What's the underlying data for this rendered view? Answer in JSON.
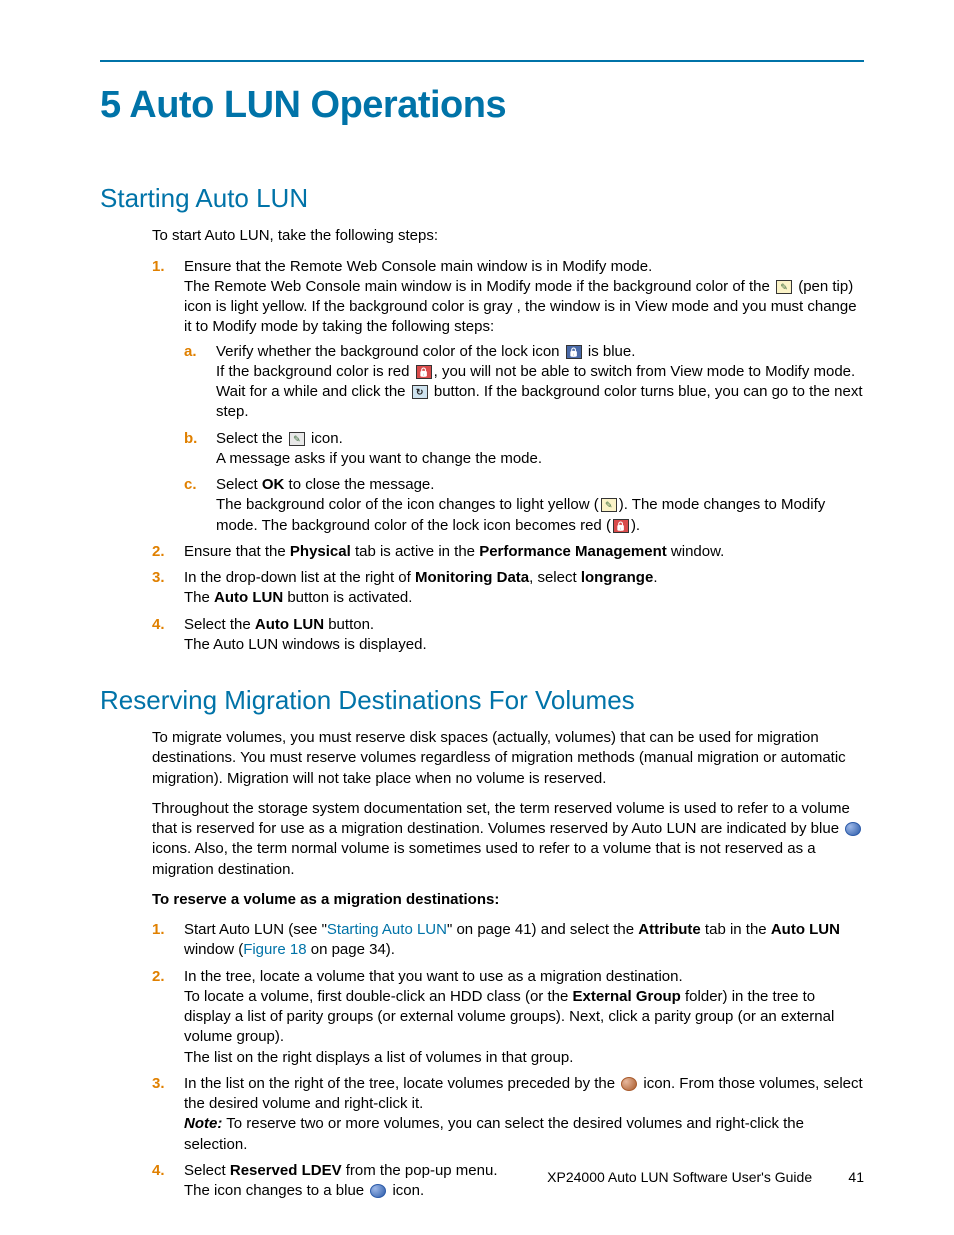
{
  "chapter": {
    "title": "5 Auto LUN Operations"
  },
  "section1": {
    "title": "Starting Auto LUN",
    "intro": "To start Auto LUN, take the following steps:",
    "item1": {
      "marker": "1.",
      "line1": "Ensure that the Remote Web Console main window is in Modify mode.",
      "line2a": "The Remote Web Console main window is in Modify mode if the background color of the ",
      "line2b": " (pen tip) icon is light yellow. If the background color is gray , the window is in View mode and you must change it to Modify mode by taking the following steps:",
      "a": {
        "marker": "a.",
        "l1a": "Verify whether the background color of the lock icon ",
        "l1b": " is blue.",
        "l2a": "If the background color is red ",
        "l2b": ", you will not be able to switch from View mode to Modify mode. Wait for a while and click the ",
        "l2c": " button. If the background color turns blue, you can go to the next step."
      },
      "b": {
        "marker": "b.",
        "l1a": "Select the ",
        "l1b": " icon.",
        "l2": "A message asks if you want to change the mode."
      },
      "c": {
        "marker": "c.",
        "l1a": "Select ",
        "l1b": "OK",
        "l1c": " to close the message.",
        "l2a": "The background color of the icon changes to light yellow (",
        "l2b": "). The mode changes to Modify mode. The background color of the lock icon becomes red (",
        "l2c": ")."
      }
    },
    "item2": {
      "marker": "2.",
      "pre": "Ensure that the ",
      "b1": "Physical",
      "mid": " tab is active in the ",
      "b2": "Performance Management",
      "post": " window."
    },
    "item3": {
      "marker": "3.",
      "pre": "In the drop-down list at the right of ",
      "b1": "Monitoring Data",
      "mid": ", select ",
      "b2": "longrange",
      "post": ".",
      "line2a": "The ",
      "line2b": "Auto LUN",
      "line2c": " button is activated."
    },
    "item4": {
      "marker": "4.",
      "pre": "Select the ",
      "b1": "Auto LUN",
      "post": " button.",
      "line2": "The Auto LUN windows is displayed."
    }
  },
  "section2": {
    "title": "Reserving Migration Destinations For Volumes",
    "p1": "To migrate volumes, you must reserve disk spaces (actually, volumes) that can be used for migration destinations. You must reserve volumes regardless of migration methods (manual migration or automatic migration). Migration will not take place when no volume is reserved.",
    "p2a": "Throughout the storage system documentation set, the term reserved volume is used to refer to a volume that is reserved for use as a migration destination. Volumes reserved by Auto LUN are indicated by blue ",
    "p2b": " icons. Also, the term normal volume is sometimes used to refer to a volume that is not reserved as a migration destination.",
    "subhead": "To reserve a volume as a migration destinations:",
    "item1": {
      "marker": "1.",
      "pre": "Start Auto LUN (see \"",
      "link1": "Starting Auto LUN",
      "mid1": "\" on page 41) and select the ",
      "b1": "Attribute",
      "mid2": " tab in the ",
      "b2": "Auto LUN",
      "mid3": " window (",
      "link2": "Figure 18",
      "post": " on page 34)."
    },
    "item2": {
      "marker": "2.",
      "l1": "In the tree, locate a volume that you want to use as a migration destination.",
      "l2a": "To locate a volume, first double-click an HDD class (or the ",
      "l2b": "External Group",
      "l2c": " folder) in the tree to display a list of parity groups (or external volume groups). Next, click a parity group (or an external volume group).",
      "l3": "The list on the right displays a list of volumes in that group."
    },
    "item3": {
      "marker": "3.",
      "l1a": "In the list on the right of the tree, locate volumes preceded by the ",
      "l1b": " icon. From those volumes, select the desired volume and right-click it.",
      "note_label": "Note:",
      "note": " To reserve two or more volumes, you can select the desired volumes and right-click the selection."
    },
    "item4": {
      "marker": "4.",
      "pre": "Select ",
      "b1": "Reserved LDEV",
      "post": " from the pop-up menu.",
      "l2a": "The icon changes to a blue ",
      "l2b": " icon."
    }
  },
  "footer": {
    "title": "XP24000 Auto LUN Software User's Guide",
    "page": "41"
  }
}
